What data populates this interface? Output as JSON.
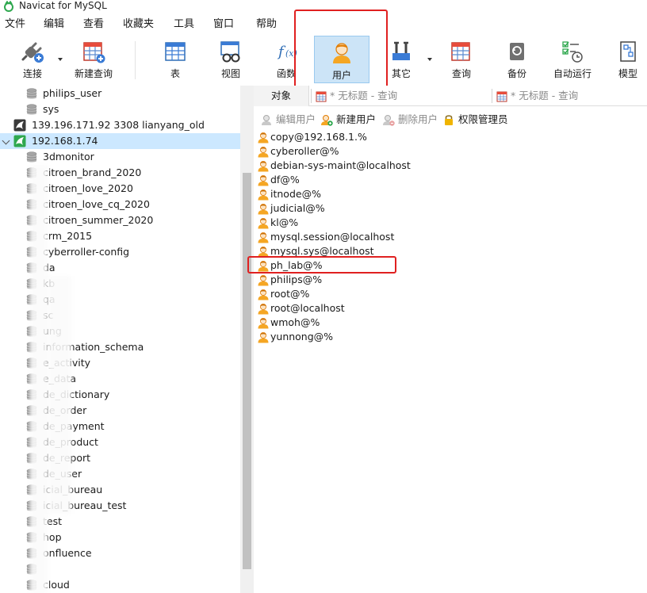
{
  "window": {
    "title": "Navicat for MySQL"
  },
  "menu": [
    "文件",
    "编辑",
    "查看",
    "收藏夹",
    "工具",
    "窗口",
    "帮助"
  ],
  "toolbar": {
    "connect": "连接",
    "new_query": "新建查询",
    "table": "表",
    "view": "视图",
    "function": "函数",
    "user": "用户",
    "other": "其它",
    "query": "查询",
    "backup": "备份",
    "automation": "自动运行",
    "model": "模型"
  },
  "tree": {
    "top_items": [
      "philips_user",
      "sys"
    ],
    "connection_old": "139.196.171.92 3308 lianyang_old",
    "connection_active": "192.168.1.74",
    "databases": [
      "3dmonitor",
      "citroen_brand_2020",
      "citroen_love_2020",
      "citroen_love_cq_2020",
      "citroen_summer_2020",
      "crm_2015",
      "cyberroller-config",
      "da",
      "kb",
      "qa",
      "sc",
      "ung",
      "information_schema",
      "e_activity",
      "e_data",
      "de_dictionary",
      "de_order",
      "de_payment",
      "de_product",
      "de_report",
      "de_user",
      "icial_bureau",
      "icial_bureau_test",
      "test",
      "hop",
      "onfluence",
      "",
      "cloud"
    ]
  },
  "tabs": {
    "objects": "对象",
    "query1": "* 无标题 - 查询",
    "query2": "* 无标题 - 查询"
  },
  "object_toolbar": {
    "edit_user": "编辑用户",
    "new_user": "新建用户",
    "delete_user": "删除用户",
    "privilege_manager": "权限管理员"
  },
  "users": [
    "copy@192.168.1.%",
    "cyberoller@%",
    "debian-sys-maint@localhost",
    "df@%",
    "itnode@%",
    "judicial@%",
    "kl@%",
    "mysql.session@localhost",
    "mysql.sys@localhost",
    "ph_lab@%",
    "philips@%",
    "root@%",
    "root@localhost",
    "wmoh@%",
    "yunnong@%"
  ],
  "colors": {
    "highlight_red": "#e02020",
    "selection_blue": "#cce8ff",
    "active_tool": "#cce4f7"
  }
}
